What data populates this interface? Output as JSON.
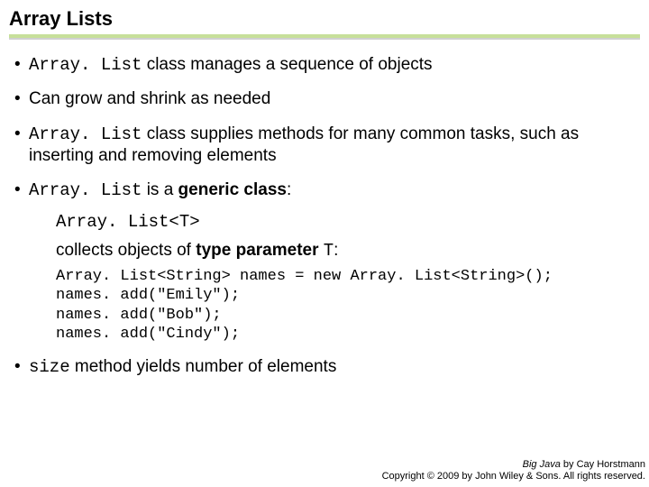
{
  "title": "Array Lists",
  "bullets": {
    "b1_code": "Array. List",
    "b1_rest": " class manages a sequence of objects",
    "b2": "Can grow and shrink as needed",
    "b3_code": "Array. List",
    "b3_rest": " class supplies methods for many common tasks, such as inserting and removing elements",
    "b4_code": "Array. List",
    "b4_mid": " is a ",
    "b4_bold": "generic class",
    "b4_after": ":",
    "b4_sub1": "Array. List<T>",
    "b4_sub2_a": "collects objects of ",
    "b4_sub2_bold": "type parameter",
    "b4_sub2_space": " ",
    "b4_sub2_code": "T",
    "b4_sub2_colon": ":",
    "b4_code1": "Array. List<String> names = new Array. List<String>();",
    "b4_code2": "names. add(\"Emily\");",
    "b4_code3": "names. add(\"Bob\");",
    "b4_code4": "names. add(\"Cindy\");",
    "b5_code": "size",
    "b5_rest": " method yields number of elements"
  },
  "footer": {
    "book": "Big Java",
    "by": " by Cay Horstmann",
    "copy": "Copyright © 2009 by John Wiley & Sons. All rights reserved."
  }
}
